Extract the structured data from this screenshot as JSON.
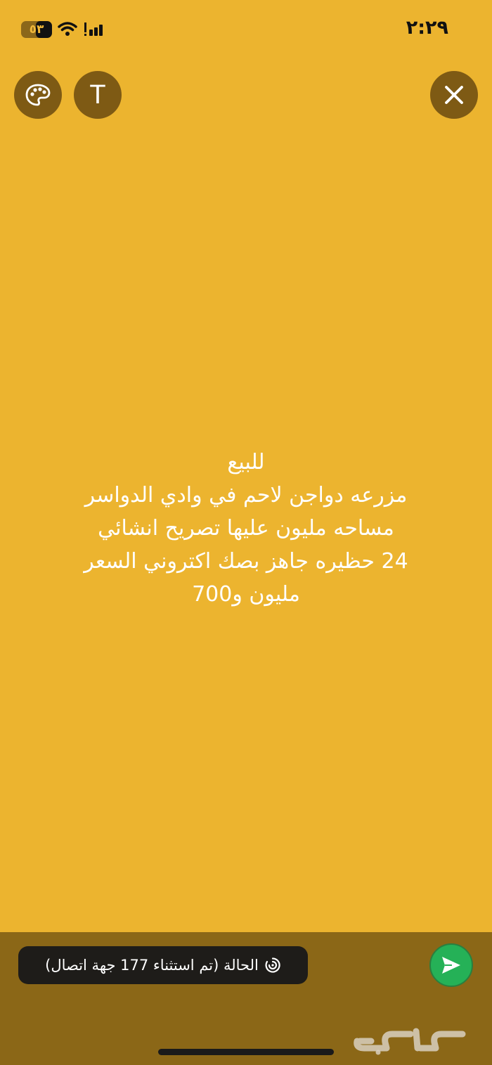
{
  "status_bar": {
    "time": "٢:٢٩",
    "battery_level": 0.53,
    "battery_label": "٥٣"
  },
  "toolbar": {
    "palette_icon": "palette-icon",
    "text_button_label": "T",
    "close_icon": "close-icon"
  },
  "story": {
    "lines": [
      "للبيع",
      "مزرعه دواجن لاحم في وادي الدواسر",
      "مساحه مليون عليها تصريح انشائي",
      "24 حظيره جاهز بصك اكتروني  السعر",
      "مليون و700"
    ]
  },
  "bottom": {
    "status_label": "الحالة (تم استثناء 177 جهة اتصال)",
    "send_icon": "send-icon"
  },
  "watermark": "حراج",
  "colors": {
    "background": "#ecb42f",
    "bottom_bar": "#8b6717",
    "send_button": "#25b157"
  }
}
